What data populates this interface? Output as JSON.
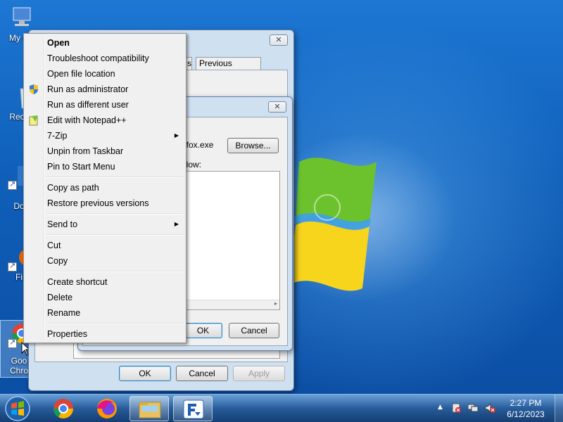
{
  "desktop": {
    "icons": [
      {
        "label": "My C",
        "name": "my-computer"
      },
      {
        "label": "Recy",
        "name": "recycle-bin"
      },
      {
        "label": "Do",
        "name": "documents-shortcut"
      },
      {
        "label": "Fi",
        "name": "firefox-shortcut"
      },
      {
        "label": "Goo Chro",
        "name": "google-chrome-shortcut"
      }
    ]
  },
  "properties_window": {
    "tabs": [
      "s",
      "Previous Versions"
    ],
    "buttons": {
      "ok": "OK",
      "cancel": "Cancel",
      "apply": "Apply"
    }
  },
  "inner_dialog": {
    "path_value": "efox.exe",
    "browse_label": "Browse...",
    "list_label": "elow:",
    "buttons": {
      "ok": "OK",
      "cancel": "Cancel"
    }
  },
  "context_menu": {
    "items": [
      {
        "label": "Open",
        "bold": true
      },
      {
        "label": "Troubleshoot compatibility"
      },
      {
        "label": "Open file location"
      },
      {
        "label": "Run as administrator",
        "icon": "uac-shield-icon"
      },
      {
        "label": "Run as different user"
      },
      {
        "label": "Edit with Notepad++",
        "icon": "notepad-plus-plus-icon"
      },
      {
        "label": "7-Zip",
        "submenu": true
      },
      {
        "label": "Unpin from Taskbar"
      },
      {
        "label": "Pin to Start Menu"
      },
      {
        "label": "Copy as path"
      },
      {
        "label": "Restore previous versions"
      },
      {
        "label": "Send to",
        "submenu": true
      },
      {
        "label": "Cut"
      },
      {
        "label": "Copy"
      },
      {
        "label": "Create shortcut"
      },
      {
        "label": "Delete"
      },
      {
        "label": "Rename"
      },
      {
        "label": "Properties"
      }
    ]
  },
  "taskbar": {
    "start_icon": "windows-orb-icon",
    "pinned": [
      {
        "name": "google-chrome-icon"
      },
      {
        "name": "firefox-icon"
      },
      {
        "name": "windows-explorer-icon"
      },
      {
        "name": "app-icon"
      }
    ],
    "clock": {
      "time": "2:27 PM",
      "date": "6/12/2023"
    }
  },
  "colors": {
    "accent": "#1a6bc4",
    "menu_bg": "#f0f0f0"
  }
}
